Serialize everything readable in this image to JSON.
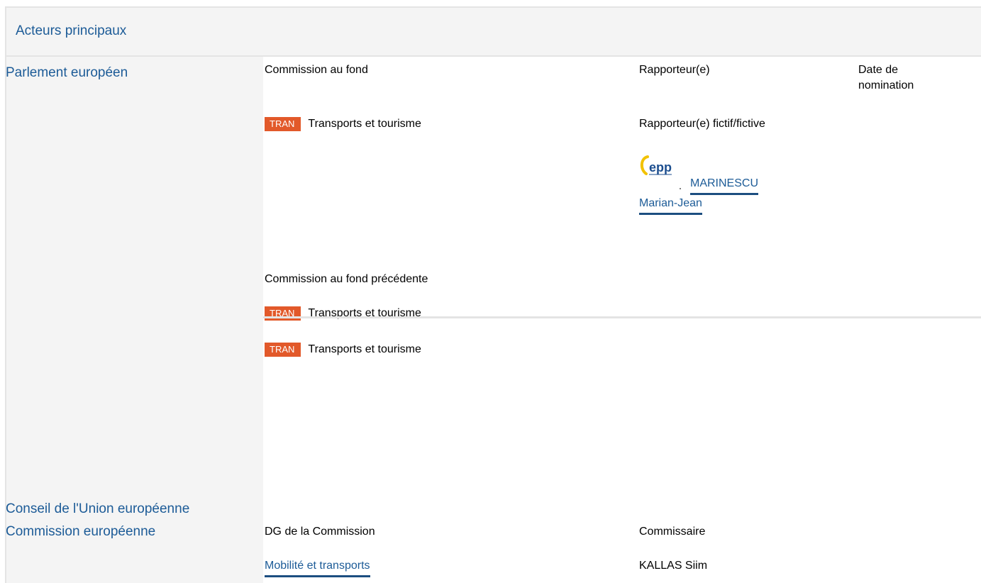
{
  "section": {
    "title": "Acteurs principaux"
  },
  "parliament": {
    "title": "Parlement européen",
    "headers": {
      "committee": "Commission au fond",
      "rapporteur": "Rapporteur(e)",
      "date": "Date de nomination"
    },
    "committee": {
      "code": "TRAN",
      "name": "Transports et tourisme"
    },
    "shadow_label": "Rapporteur(e) fictif/fictive",
    "shadow_party_logo": "epp-logo",
    "shadow_party_text": "epp",
    "shadow_name_part1": "MARINESCU",
    "shadow_name_part2": "Marian-Jean",
    "previous_label": "Commission au fond précédente",
    "previous_committee": {
      "code": "TRAN",
      "name": "Transports et tourisme"
    },
    "other_committee": {
      "code": "TRAN",
      "name": "Transports et tourisme"
    }
  },
  "council": {
    "title": "Conseil de l'Union européenne"
  },
  "commission": {
    "title": "Commission européenne",
    "headers": {
      "dg": "DG de la Commission",
      "commissioner": "Commissaire"
    },
    "dg_link": "Mobilité et transports",
    "commissioner": "KALLAS Siim"
  },
  "colors": {
    "accent": "#1c5b97",
    "badge": "#e2592a",
    "panel": "#f4f4f4"
  }
}
